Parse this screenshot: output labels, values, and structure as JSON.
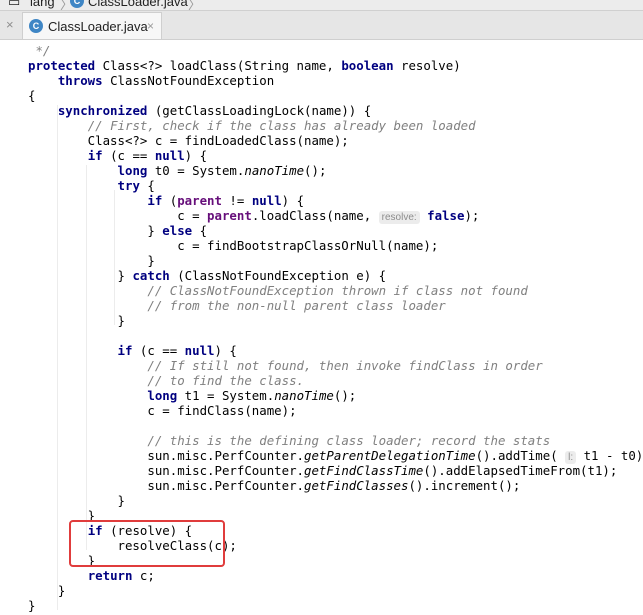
{
  "breadcrumb": {
    "items": [
      "lang",
      "ClassLoader.java"
    ]
  },
  "tabs": [
    {
      "label": "ClassLoader.java",
      "active": true,
      "icon": "java-class-icon",
      "close": "×"
    }
  ],
  "code_lines": [
    {
      "text": " */",
      "segs": [
        [
          "cm",
          " */"
        ]
      ]
    },
    {
      "segs": [
        [
          "kw",
          "protected"
        ],
        [
          "n",
          " Class<?> loadClass(String name, "
        ],
        [
          "kw",
          "boolean"
        ],
        [
          "n",
          " resolve)"
        ]
      ]
    },
    {
      "segs": [
        [
          "n",
          "    "
        ],
        [
          "kw",
          "throws"
        ],
        [
          "n",
          " ClassNotFoundException"
        ]
      ]
    },
    {
      "segs": [
        [
          "n",
          "{"
        ]
      ]
    },
    {
      "segs": [
        [
          "n",
          "    "
        ],
        [
          "kw",
          "synchronized"
        ],
        [
          "n",
          " (getClassLoadingLock(name)) {"
        ]
      ]
    },
    {
      "segs": [
        [
          "n",
          "        "
        ],
        [
          "cm",
          "// First, check if the class has already been loaded"
        ]
      ]
    },
    {
      "segs": [
        [
          "n",
          "        Class<?> c = findLoadedClass(name);"
        ]
      ]
    },
    {
      "segs": [
        [
          "n",
          "        "
        ],
        [
          "kw",
          "if"
        ],
        [
          "n",
          " (c == "
        ],
        [
          "kw",
          "null"
        ],
        [
          "n",
          ") {"
        ]
      ]
    },
    {
      "segs": [
        [
          "n",
          "            "
        ],
        [
          "kw",
          "long"
        ],
        [
          "n",
          " t0 = System."
        ],
        [
          "it",
          "nanoTime"
        ],
        [
          "n",
          "();"
        ]
      ]
    },
    {
      "segs": [
        [
          "n",
          "            "
        ],
        [
          "kw",
          "try"
        ],
        [
          "n",
          " {"
        ]
      ]
    },
    {
      "segs": [
        [
          "n",
          "                "
        ],
        [
          "kw",
          "if"
        ],
        [
          "n",
          " ("
        ],
        [
          "f",
          "parent"
        ],
        [
          "n",
          " != "
        ],
        [
          "kw",
          "null"
        ],
        [
          "n",
          ") {"
        ]
      ]
    },
    {
      "segs": [
        [
          "n",
          "                    c = "
        ],
        [
          "f",
          "parent"
        ],
        [
          "n",
          ".loadClass(name, "
        ],
        [
          "hint",
          "resolve:"
        ],
        [
          "n",
          " "
        ],
        [
          "kw",
          "false"
        ],
        [
          "n",
          ");"
        ]
      ]
    },
    {
      "segs": [
        [
          "n",
          "                } "
        ],
        [
          "kw",
          "else"
        ],
        [
          "n",
          " {"
        ]
      ]
    },
    {
      "segs": [
        [
          "n",
          "                    c = findBootstrapClassOrNull(name);"
        ]
      ]
    },
    {
      "segs": [
        [
          "n",
          "                }"
        ]
      ]
    },
    {
      "segs": [
        [
          "n",
          "            } "
        ],
        [
          "kw",
          "catch"
        ],
        [
          "n",
          " (ClassNotFoundException e) {"
        ]
      ]
    },
    {
      "segs": [
        [
          "n",
          "                "
        ],
        [
          "cm",
          "// ClassNotFoundException thrown if class not found"
        ]
      ]
    },
    {
      "segs": [
        [
          "n",
          "                "
        ],
        [
          "cm",
          "// from the non-null parent class loader"
        ]
      ]
    },
    {
      "segs": [
        [
          "n",
          "            }"
        ]
      ]
    },
    {
      "segs": [
        [
          "n",
          ""
        ]
      ]
    },
    {
      "segs": [
        [
          "n",
          "            "
        ],
        [
          "kw",
          "if"
        ],
        [
          "n",
          " (c == "
        ],
        [
          "kw",
          "null"
        ],
        [
          "n",
          ") {"
        ]
      ]
    },
    {
      "segs": [
        [
          "n",
          "                "
        ],
        [
          "cm",
          "// If still not found, then invoke findClass in order"
        ]
      ]
    },
    {
      "segs": [
        [
          "n",
          "                "
        ],
        [
          "cm",
          "// to find the class."
        ]
      ]
    },
    {
      "segs": [
        [
          "n",
          "                "
        ],
        [
          "kw",
          "long"
        ],
        [
          "n",
          " t1 = System."
        ],
        [
          "it",
          "nanoTime"
        ],
        [
          "n",
          "();"
        ]
      ]
    },
    {
      "segs": [
        [
          "n",
          "                c = findClass(name);"
        ]
      ]
    },
    {
      "segs": [
        [
          "n",
          ""
        ]
      ]
    },
    {
      "segs": [
        [
          "n",
          "                "
        ],
        [
          "cm",
          "// this is the defining class loader; record the stats"
        ]
      ]
    },
    {
      "segs": [
        [
          "n",
          "                sun.misc.PerfCounter."
        ],
        [
          "it",
          "getParentDelegationTime"
        ],
        [
          "n",
          "().addTime( "
        ],
        [
          "hint",
          "l:"
        ],
        [
          "n",
          " t1 - t0);"
        ]
      ]
    },
    {
      "segs": [
        [
          "n",
          "                sun.misc.PerfCounter."
        ],
        [
          "it",
          "getFindClassTime"
        ],
        [
          "n",
          "().addElapsedTimeFrom(t1);"
        ]
      ]
    },
    {
      "segs": [
        [
          "n",
          "                sun.misc.PerfCounter."
        ],
        [
          "it",
          "getFindClasses"
        ],
        [
          "n",
          "().increment();"
        ]
      ]
    },
    {
      "segs": [
        [
          "n",
          "            }"
        ]
      ]
    },
    {
      "segs": [
        [
          "n",
          "        }"
        ]
      ]
    },
    {
      "segs": [
        [
          "n",
          "        "
        ],
        [
          "kw",
          "if"
        ],
        [
          "n",
          " (resolve) {"
        ]
      ]
    },
    {
      "segs": [
        [
          "n",
          "            resolveClass(c);"
        ]
      ]
    },
    {
      "segs": [
        [
          "n",
          "        }"
        ]
      ]
    },
    {
      "segs": [
        [
          "n",
          "        "
        ],
        [
          "kw",
          "return"
        ],
        [
          "n",
          " c;"
        ]
      ]
    },
    {
      "segs": [
        [
          "n",
          "    }"
        ]
      ]
    },
    {
      "segs": [
        [
          "n",
          "}"
        ]
      ]
    }
  ],
  "colors": {
    "keyword": "#000080",
    "comment": "#808080",
    "field": "#660e7a",
    "highlight_box": "#e03c3c"
  }
}
